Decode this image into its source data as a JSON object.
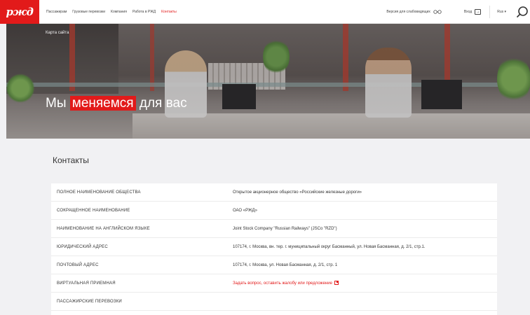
{
  "header": {
    "logo_text": "ржд",
    "nav": [
      {
        "label": "Пассажирам",
        "active": false
      },
      {
        "label": "Грузовые перевозки",
        "active": false
      },
      {
        "label": "Компания",
        "active": false
      },
      {
        "label": "Работа в РЖД",
        "active": false
      },
      {
        "label": "Контакты",
        "active": true
      }
    ],
    "accessibility_label": "Версия для слабовидящих",
    "login_label": "Вход",
    "language": "Rus ▾"
  },
  "hero": {
    "breadcrumb": "Карта сайта",
    "title_prefix": "Мы ",
    "title_highlight": "меняемся",
    "title_suffix": " для вас"
  },
  "contacts": {
    "title": "Контакты",
    "rows": [
      {
        "label": "Полное наименование общества",
        "value": "Открытое акционерное общество «Российские железные дороги»"
      },
      {
        "label": "Сокращенное наименование",
        "value": "ОАО «РЖД»"
      },
      {
        "label": "Наименование на английском языке",
        "value": "Joint Stock Company \"Russian Railways\" (JSCo \"RZD\")"
      },
      {
        "label": "Юридический адрес",
        "value": "107174, г. Москва, вн. тер. г. муниципальный округ Басманный, ул. Новая Басманная, д. 2/1, стр.1."
      },
      {
        "label": "Почтовый адрес",
        "value": "107174, г. Москва, ул. Новая Басманная, д. 2/1, стр. 1"
      },
      {
        "label": "Виртуальная приемная",
        "value": "Задать вопрос, оставить жалобу или предложение"
      },
      {
        "label": "Пассажирские перевозки",
        "value": ""
      }
    ]
  },
  "colors": {
    "brand_red": "#e21a1a",
    "page_bg": "#f1f1f3"
  }
}
